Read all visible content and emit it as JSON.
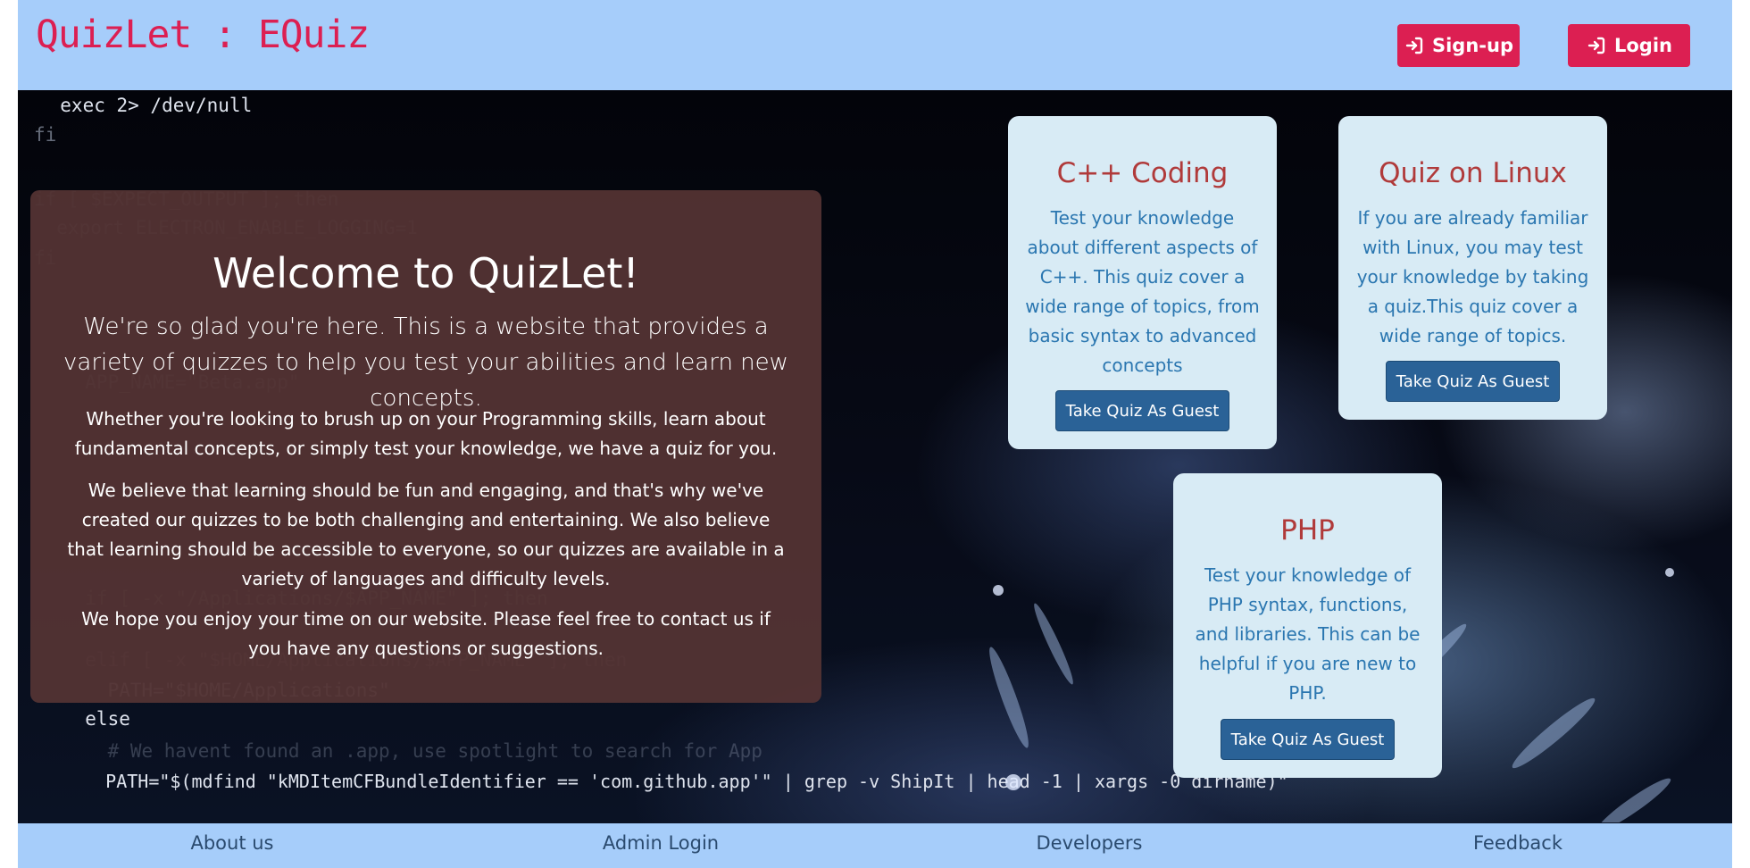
{
  "header": {
    "brand": "QuizLet : EQuiz",
    "signup_label": "Sign-up",
    "login_label": "Login"
  },
  "hero": {
    "code_lines": [
      "  exec 2> /dev/null",
      "fi",
      "if [ $EXPECT_OUTPUT ]; then",
      "  export ELECTRON_ENABLE_LOGGING=1",
      "fi",
      "  APP_NAME=\"Beta.app\"",
      "  if [ -x \"/Applications/$APP_NAME\" ]; then",
      "  elif [ -x \"$HOME/Applications/$APP_NAME\" ]; then",
      "    PATH=\"$HOME/Applications\"",
      "  else",
      "    # We havent found an .app, use spotlight to search for App",
      "    PATH=\"$(mdfind \"kMDItemCFBundleIdentifier == 'com.github.app'\" | grep -v ShipIt | head -1 | xargs -0 dirname)\""
    ]
  },
  "welcome": {
    "title": "Welcome to QuizLet!",
    "lead": "We're so glad you're here. This is a website that provides a variety of quizzes to help you test your abilities and learn new concepts.",
    "p1": "Whether you're looking to brush up on your Programming skills, learn about fundamental concepts, or simply test your knowledge, we have a quiz for you.",
    "p2": "We believe that learning should be fun and engaging, and that's why we've created our quizzes to be both challenging and entertaining. We also believe that learning should be accessible to everyone, so our quizzes are available in a variety of languages and difficulty levels.",
    "p3": "We hope you enjoy your time on our website. Please feel free to contact us if you have any questions or suggestions."
  },
  "cards": [
    {
      "title": "C++ Coding",
      "desc": "Test your knowledge about different aspects of C++. This quiz cover a wide range of topics, from basic syntax to advanced concepts",
      "button": "Take Quiz As Guest"
    },
    {
      "title": "Quiz on Linux",
      "desc": "If you are already familiar with Linux, you may test your knowledge by taking a quiz.This quiz cover a wide range of topics.",
      "button": "Take Quiz As Guest"
    },
    {
      "title": "PHP",
      "desc": "Test your knowledge of PHP syntax, functions, and libraries. This can be helpful if you are new to PHP.",
      "button": "Take Quiz As Guest"
    }
  ],
  "footer": {
    "about": "About us",
    "admin": "Admin Login",
    "developers": "Developers",
    "feedback": "Feedback"
  },
  "colors": {
    "nav_bg": "#a6cdfa",
    "brand": "#dc1f52",
    "card_bg": "#d8ebf5",
    "card_title": "#b03a3a",
    "card_text": "#2a76b0",
    "button": "#2a6297"
  },
  "icons": {
    "signup": "sign-in-icon",
    "login": "sign-in-icon"
  }
}
